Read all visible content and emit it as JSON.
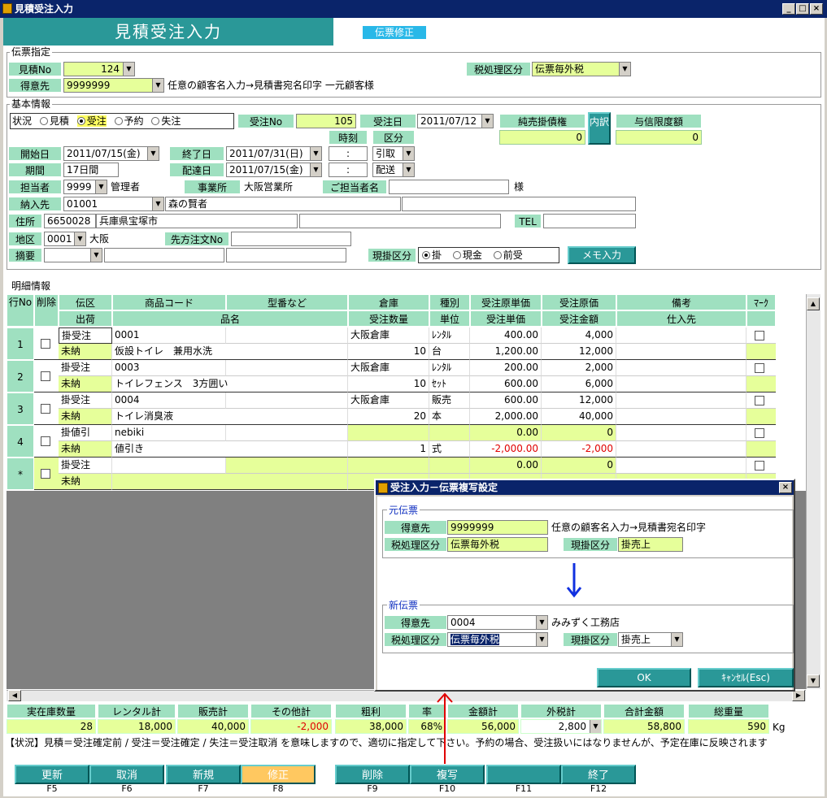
{
  "window": {
    "title": "見積受注入力",
    "screen_title": "見積受注入力",
    "mode": "伝票修正"
  },
  "denpyo": {
    "section": "伝票指定",
    "mitsumori_label": "見積No",
    "mitsumori_value": "124",
    "tokuisaki_label": "得意先",
    "tokuisaki_code": "9999999",
    "tokuisaki_name": "任意の顧客名入力→見積書宛名印字 一元顧客様",
    "tax_label": "税処理区分",
    "tax_value": "伝票毎外税"
  },
  "kihon": {
    "section": "基本情報",
    "status_label": "状況",
    "status_options": [
      "見積",
      "受注",
      "予約",
      "失注"
    ],
    "status_selected": 1,
    "juchu_no_label": "受注No",
    "juchu_no": "105",
    "juchu_date_label": "受注日",
    "juchu_date": "2011/07/12",
    "junuri_label": "純売掛債権",
    "junuri_value": "0",
    "uchiwake": "内訳",
    "yoshin_label": "与信限度額",
    "yoshin_value": "0",
    "jikoku_label": "時刻",
    "kubun_label": "区分",
    "start_label": "開始日",
    "start_date": "2011/07/15(金)",
    "end_label": "終了日",
    "end_date": "2011/07/31(日)",
    "time1": ":",
    "kubun1": "引取",
    "kikan_label": "期間",
    "kikan_value": "17日間",
    "haisou_label": "配達日",
    "haisou_date": "2011/07/15(金)",
    "time2": ":",
    "kubun2": "配送",
    "tanto_label": "担当者",
    "tanto_code": "9999",
    "tanto_name": "管理者",
    "jigyosho_label": "事業所",
    "jigyosho_value": "大阪営業所",
    "gotanto_label": "ご担当者名",
    "sama": "様",
    "nonyu_label": "納入先",
    "nonyu_code": "01001",
    "nonyu_name": "森の賢者",
    "jusho_label": "住所",
    "zip": "6650028",
    "address": "兵庫県宝塚市",
    "tel_label": "TEL",
    "chiku_label": "地区",
    "chiku_code": "0001",
    "chiku_name": "大阪",
    "sakikata_label": "先方注文No",
    "tekiyo_label": "摘要",
    "genkake_label": "現掛区分",
    "genkake_options": [
      "掛",
      "現金",
      "前受"
    ],
    "genkake_selected": 0,
    "memo_btn": "メモ入力"
  },
  "meisai": {
    "section": "明細情報",
    "headers_top": [
      "行No",
      "削除",
      "伝区",
      "商品コード",
      "型番など",
      "倉庫",
      "種別",
      "受注原単価",
      "受注原価",
      "備考",
      "ﾏｰｸ"
    ],
    "headers_bottom": [
      "出荷",
      "品名",
      "受注数量",
      "単位",
      "受注単価",
      "受注金額",
      "仕入先"
    ],
    "rows": [
      {
        "no": "1",
        "denku": "掛受注",
        "code": "0001",
        "soko": "大阪倉庫",
        "shubetsu": "ﾚﾝﾀﾙ",
        "gen_tanka": "400.00",
        "genka": "4,000",
        "shukka": "未納",
        "hinmei": "仮設トイレ　兼用水洗",
        "suryo": "10",
        "tani": "台",
        "tanka": "1,200.00",
        "kingaku": "12,000"
      },
      {
        "no": "2",
        "denku": "掛受注",
        "code": "0003",
        "soko": "大阪倉庫",
        "shubetsu": "ﾚﾝﾀﾙ",
        "gen_tanka": "200.00",
        "genka": "2,000",
        "shukka": "未納",
        "hinmei": "トイレフェンス　3方囲い",
        "suryo": "10",
        "tani": "ｾｯﾄ",
        "tanka": "600.00",
        "kingaku": "6,000"
      },
      {
        "no": "3",
        "denku": "掛受注",
        "code": "0004",
        "soko": "大阪倉庫",
        "shubetsu": "販売",
        "gen_tanka": "600.00",
        "genka": "12,000",
        "shukka": "未納",
        "hinmei": "トイレ消臭液",
        "suryo": "20",
        "tani": "本",
        "tanka": "2,000.00",
        "kingaku": "40,000"
      },
      {
        "no": "4",
        "denku": "掛値引",
        "code": "nebiki",
        "soko": "",
        "shubetsu": "",
        "gen_tanka": "0.00",
        "genka": "0",
        "shukka": "未納",
        "hinmei": "値引き",
        "suryo": "1",
        "tani": "式",
        "tanka": "-2,000.00",
        "kingaku": "-2,000"
      },
      {
        "no": "*",
        "denku": "掛受注",
        "code": "",
        "soko": "",
        "shubetsu": "",
        "gen_tanka": "0.00",
        "genka": "0",
        "shukka": "未納",
        "hinmei": "",
        "suryo": "",
        "tani": "",
        "tanka": "",
        "kingaku": ""
      }
    ]
  },
  "totals": {
    "labels": [
      "実在庫数量",
      "レンタル計",
      "販売計",
      "その他計",
      "粗利",
      "率",
      "金額計",
      "外税計",
      "合計金額",
      "総重量"
    ],
    "values": [
      "28",
      "18,000",
      "40,000",
      "-2,000",
      "38,000",
      "68%",
      "56,000",
      "2,800",
      "58,800",
      "590"
    ],
    "unit": "Kg"
  },
  "status_msg": "【状況】見積＝受注確定前 / 受注＝受注確定 / 失注＝受注取消 を意味しますので、適切に指定して下さい。予約の場合、受注扱いにはなりませんが、予定在庫に反映されます",
  "fkeys": [
    {
      "label": "更新",
      "key": "F5"
    },
    {
      "label": "取消",
      "key": "F6"
    },
    {
      "label": "新規",
      "key": "F7"
    },
    {
      "label": "修正",
      "key": "F8"
    },
    {
      "label": "削除",
      "key": "F9"
    },
    {
      "label": "複写",
      "key": "F10"
    },
    {
      "label": "",
      "key": "F11"
    },
    {
      "label": "終了",
      "key": "F12"
    }
  ],
  "dialog": {
    "title": "受注入力－伝票複写設定",
    "moto_section": "元伝票",
    "moto_tokuisaki_label": "得意先",
    "moto_tokuisaki_code": "9999999",
    "moto_tokuisaki_name": "任意の顧客名入力→見積書宛名印字",
    "moto_tax_label": "税処理区分",
    "moto_tax_value": "伝票毎外税",
    "moto_genkake_label": "現掛区分",
    "moto_genkake_value": "掛売上",
    "shin_section": "新伝票",
    "shin_tokuisaki_label": "得意先",
    "shin_tokuisaki_code": "0004",
    "shin_tokuisaki_name": "みみずく工務店",
    "shin_tax_label": "税処理区分",
    "shin_tax_value": "伝票毎外税",
    "shin_genkake_label": "現掛区分",
    "shin_genkake_value": "掛売上",
    "ok": "OK",
    "cancel": "ｷｬﾝｾﾙ(Esc)"
  },
  "colors": {
    "teal": "#2a9898",
    "label_green": "#9fe0c0",
    "field_yellow": "#e6ff9a",
    "title_blue": "#0a246a",
    "arrow_blue": "#1030e0",
    "negative_red": "#e00000"
  }
}
